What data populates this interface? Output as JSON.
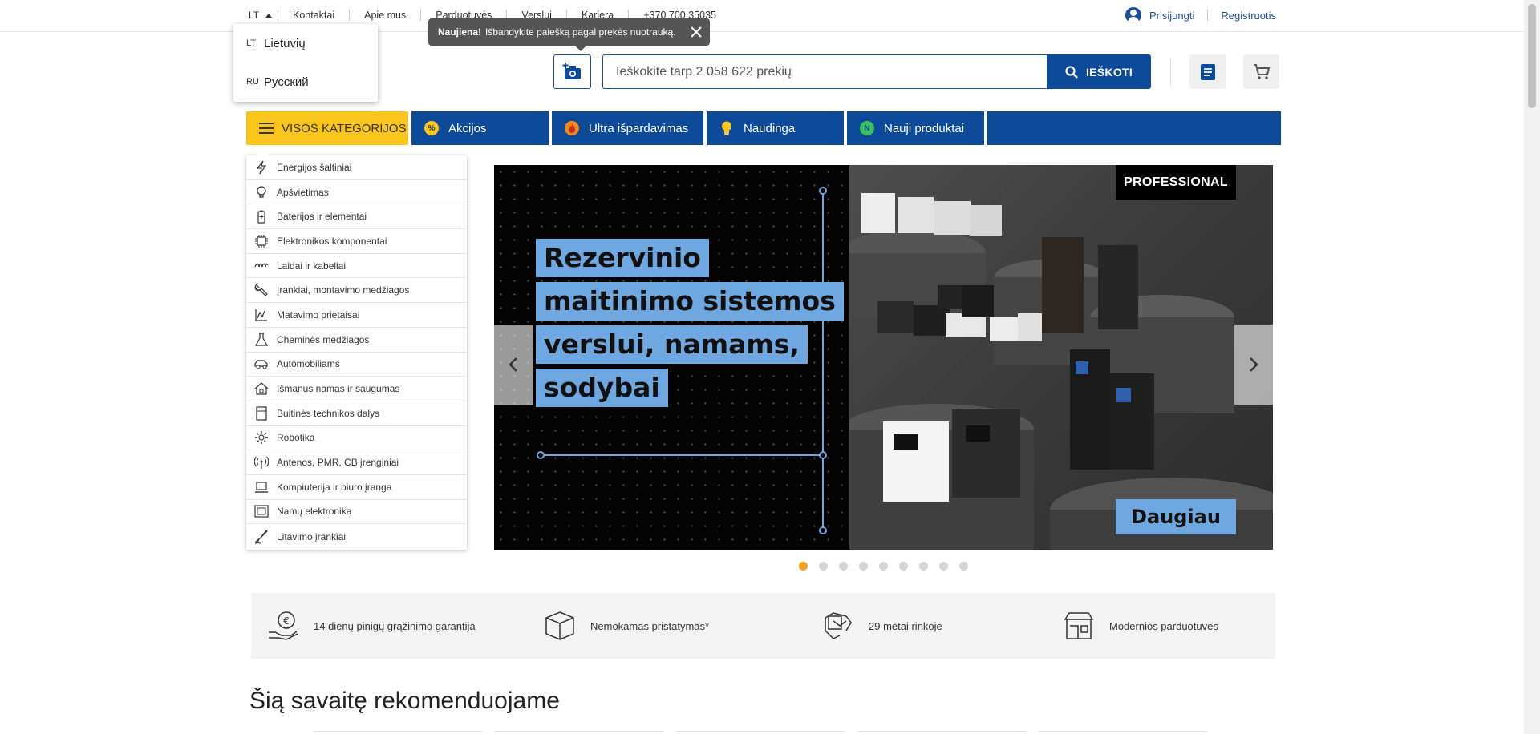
{
  "language": {
    "current_code": "LT",
    "options": [
      {
        "code": "LT",
        "label": "Lietuvių"
      },
      {
        "code": "RU",
        "label": "Русский"
      }
    ]
  },
  "top_links": [
    "Kontaktai",
    "Apie mus",
    "Parduotuvės",
    "Verslui",
    "Karjera",
    "+370 700 35035"
  ],
  "account": {
    "login": "Prisijungti",
    "register": "Registruotis"
  },
  "tooltip": {
    "strong": "Naujiena!",
    "text": "Išbandykite paiešką pagal prekės nuotrauką."
  },
  "search": {
    "placeholder": "Ieškokite tarp 2 058 622 prekių",
    "button_label": "IEŠKOTI"
  },
  "nav": {
    "all_categories": "VISOS KATEGORIJOS",
    "items": [
      {
        "label": "Akcijos",
        "icon": "discount-icon"
      },
      {
        "label": "Ultra išpardavimas",
        "icon": "fire-icon"
      },
      {
        "label": "Naudinga",
        "icon": "lightbulb-icon"
      },
      {
        "label": "Nauji produktai",
        "icon": "new-badge-icon"
      }
    ]
  },
  "categories": [
    {
      "label": "Energijos šaltiniai",
      "icon": "lightning-icon"
    },
    {
      "label": "Apšvietimas",
      "icon": "bulb-icon"
    },
    {
      "label": "Baterijos ir elementai",
      "icon": "battery-icon"
    },
    {
      "label": "Elektronikos komponentai",
      "icon": "chip-icon"
    },
    {
      "label": "Laidai ir kabeliai",
      "icon": "cable-icon"
    },
    {
      "label": "Įrankiai, montavimo medžiagos",
      "icon": "wrench-icon"
    },
    {
      "label": "Matavimo prietaisai",
      "icon": "meter-icon"
    },
    {
      "label": "Cheminės medžiagos",
      "icon": "flask-icon"
    },
    {
      "label": "Automobiliams",
      "icon": "car-icon"
    },
    {
      "label": "Išmanus namas ir saugumas",
      "icon": "house-icon"
    },
    {
      "label": "Buitinės technikos dalys",
      "icon": "appliance-icon"
    },
    {
      "label": "Robotika",
      "icon": "gear-icon"
    },
    {
      "label": "Antenos, PMR, CB įrenginiai",
      "icon": "antenna-icon"
    },
    {
      "label": "Kompiuterija ir biuro įranga",
      "icon": "laptop-icon"
    },
    {
      "label": "Namų elektronika",
      "icon": "tv-icon"
    },
    {
      "label": "Litavimo įrankiai",
      "icon": "soldering-icon"
    }
  ],
  "banner": {
    "headline_lines": [
      "Rezervinio",
      "maitinimo sistemos",
      "verslui, namams,",
      "sodybai"
    ],
    "badge": "PROFESSIONAL",
    "more_label": "Daugiau",
    "slide_count": 9,
    "active_slide": 1
  },
  "features": [
    {
      "text": "14 dienų pinigų grąžinimo garantija",
      "icon": "money-back-icon"
    },
    {
      "text": "Nemokamas pristatymas*",
      "icon": "box-icon"
    },
    {
      "text": "29 metai rinkoje",
      "icon": "handshake-icon"
    },
    {
      "text": "Modernios parduotuvės",
      "icon": "store-icon"
    }
  ],
  "recommend_title": "Šią savaitę rekomenduojame",
  "colors": {
    "primary_blue": "#0e4a9a",
    "accent_yellow": "#fbc61b",
    "banner_blue": "#6fa8e0",
    "dot_active": "#f0a21b"
  }
}
